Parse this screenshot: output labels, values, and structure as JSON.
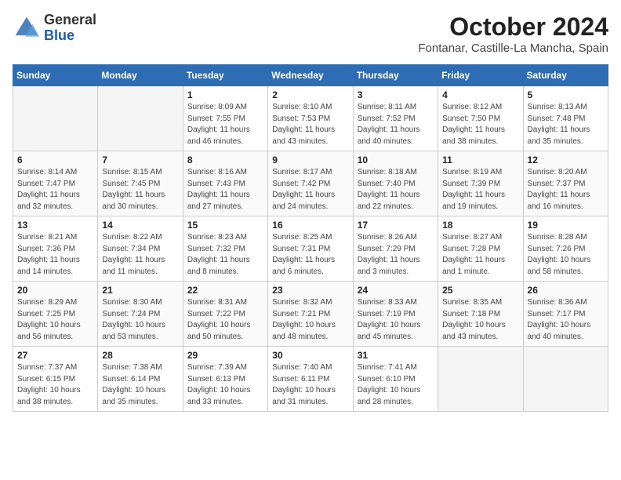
{
  "logo": {
    "general": "General",
    "blue": "Blue"
  },
  "title": "October 2024",
  "subtitle": "Fontanar, Castille-La Mancha, Spain",
  "days_of_week": [
    "Sunday",
    "Monday",
    "Tuesday",
    "Wednesday",
    "Thursday",
    "Friday",
    "Saturday"
  ],
  "weeks": [
    [
      {
        "day": "",
        "info": ""
      },
      {
        "day": "",
        "info": ""
      },
      {
        "day": "1",
        "info": "Sunrise: 8:09 AM\nSunset: 7:55 PM\nDaylight: 11 hours and 46 minutes."
      },
      {
        "day": "2",
        "info": "Sunrise: 8:10 AM\nSunset: 7:53 PM\nDaylight: 11 hours and 43 minutes."
      },
      {
        "day": "3",
        "info": "Sunrise: 8:11 AM\nSunset: 7:52 PM\nDaylight: 11 hours and 40 minutes."
      },
      {
        "day": "4",
        "info": "Sunrise: 8:12 AM\nSunset: 7:50 PM\nDaylight: 11 hours and 38 minutes."
      },
      {
        "day": "5",
        "info": "Sunrise: 8:13 AM\nSunset: 7:48 PM\nDaylight: 11 hours and 35 minutes."
      }
    ],
    [
      {
        "day": "6",
        "info": "Sunrise: 8:14 AM\nSunset: 7:47 PM\nDaylight: 11 hours and 32 minutes."
      },
      {
        "day": "7",
        "info": "Sunrise: 8:15 AM\nSunset: 7:45 PM\nDaylight: 11 hours and 30 minutes."
      },
      {
        "day": "8",
        "info": "Sunrise: 8:16 AM\nSunset: 7:43 PM\nDaylight: 11 hours and 27 minutes."
      },
      {
        "day": "9",
        "info": "Sunrise: 8:17 AM\nSunset: 7:42 PM\nDaylight: 11 hours and 24 minutes."
      },
      {
        "day": "10",
        "info": "Sunrise: 8:18 AM\nSunset: 7:40 PM\nDaylight: 11 hours and 22 minutes."
      },
      {
        "day": "11",
        "info": "Sunrise: 8:19 AM\nSunset: 7:39 PM\nDaylight: 11 hours and 19 minutes."
      },
      {
        "day": "12",
        "info": "Sunrise: 8:20 AM\nSunset: 7:37 PM\nDaylight: 11 hours and 16 minutes."
      }
    ],
    [
      {
        "day": "13",
        "info": "Sunrise: 8:21 AM\nSunset: 7:36 PM\nDaylight: 11 hours and 14 minutes."
      },
      {
        "day": "14",
        "info": "Sunrise: 8:22 AM\nSunset: 7:34 PM\nDaylight: 11 hours and 11 minutes."
      },
      {
        "day": "15",
        "info": "Sunrise: 8:23 AM\nSunset: 7:32 PM\nDaylight: 11 hours and 8 minutes."
      },
      {
        "day": "16",
        "info": "Sunrise: 8:25 AM\nSunset: 7:31 PM\nDaylight: 11 hours and 6 minutes."
      },
      {
        "day": "17",
        "info": "Sunrise: 8:26 AM\nSunset: 7:29 PM\nDaylight: 11 hours and 3 minutes."
      },
      {
        "day": "18",
        "info": "Sunrise: 8:27 AM\nSunset: 7:28 PM\nDaylight: 11 hours and 1 minute."
      },
      {
        "day": "19",
        "info": "Sunrise: 8:28 AM\nSunset: 7:26 PM\nDaylight: 10 hours and 58 minutes."
      }
    ],
    [
      {
        "day": "20",
        "info": "Sunrise: 8:29 AM\nSunset: 7:25 PM\nDaylight: 10 hours and 56 minutes."
      },
      {
        "day": "21",
        "info": "Sunrise: 8:30 AM\nSunset: 7:24 PM\nDaylight: 10 hours and 53 minutes."
      },
      {
        "day": "22",
        "info": "Sunrise: 8:31 AM\nSunset: 7:22 PM\nDaylight: 10 hours and 50 minutes."
      },
      {
        "day": "23",
        "info": "Sunrise: 8:32 AM\nSunset: 7:21 PM\nDaylight: 10 hours and 48 minutes."
      },
      {
        "day": "24",
        "info": "Sunrise: 8:33 AM\nSunset: 7:19 PM\nDaylight: 10 hours and 45 minutes."
      },
      {
        "day": "25",
        "info": "Sunrise: 8:35 AM\nSunset: 7:18 PM\nDaylight: 10 hours and 43 minutes."
      },
      {
        "day": "26",
        "info": "Sunrise: 8:36 AM\nSunset: 7:17 PM\nDaylight: 10 hours and 40 minutes."
      }
    ],
    [
      {
        "day": "27",
        "info": "Sunrise: 7:37 AM\nSunset: 6:15 PM\nDaylight: 10 hours and 38 minutes."
      },
      {
        "day": "28",
        "info": "Sunrise: 7:38 AM\nSunset: 6:14 PM\nDaylight: 10 hours and 35 minutes."
      },
      {
        "day": "29",
        "info": "Sunrise: 7:39 AM\nSunset: 6:13 PM\nDaylight: 10 hours and 33 minutes."
      },
      {
        "day": "30",
        "info": "Sunrise: 7:40 AM\nSunset: 6:11 PM\nDaylight: 10 hours and 31 minutes."
      },
      {
        "day": "31",
        "info": "Sunrise: 7:41 AM\nSunset: 6:10 PM\nDaylight: 10 hours and 28 minutes."
      },
      {
        "day": "",
        "info": ""
      },
      {
        "day": "",
        "info": ""
      }
    ]
  ]
}
